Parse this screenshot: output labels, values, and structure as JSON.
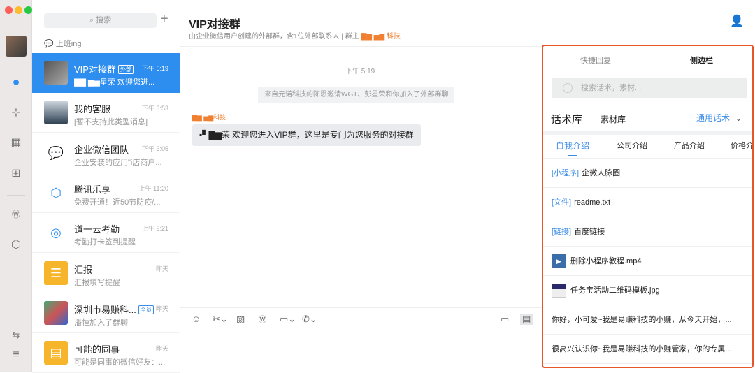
{
  "rail": {
    "items": [
      "avatar",
      "chat-icon",
      "contacts-icon",
      "calendar-icon",
      "apps-icon",
      "document-icon",
      "workbench-icon",
      "switch-icon",
      "menu-icon"
    ]
  },
  "list": {
    "search_placeholder": "搜索",
    "status": "上班ing",
    "items": [
      {
        "name": "VIP对接群",
        "badge": "外部",
        "time": "下午 5:19",
        "sub": "▇▇ ▆▅星荣 欢迎您进...",
        "selected": true
      },
      {
        "name": "我的客服",
        "time": "下午 3:53",
        "sub": "[暂不支持此类型消息]"
      },
      {
        "name": "企业微信团队",
        "time": "下午 3:05",
        "sub": "企业安装的应用\"i店商户..."
      },
      {
        "name": "腾讯乐享",
        "time": "上午 11:20",
        "sub": "免费开通！近50节防疫/..."
      },
      {
        "name": "道一云考勤",
        "time": "上午 9:21",
        "sub": "考勤打卡签到提醒"
      },
      {
        "name": "汇报",
        "time": "昨天",
        "sub": "汇报填写提醒"
      },
      {
        "name": "深圳市易赚科...",
        "badge": "全员",
        "time": "昨天",
        "sub": "潘恒加入了群聊"
      },
      {
        "name": "可能的同事",
        "time": "昨天",
        "sub": "可能是同事的微信好友：..."
      }
    ]
  },
  "chat": {
    "title": "VIP对接群",
    "subtitle": "由企业微信用户创建的外部群，含1位外部联系人 | 群主",
    "owner": "▇▆ ▅▆ 科技",
    "time": "下午 5:19",
    "system": "来自元诺科技的陈思邀请WGT、彭星荣和你加入了外部群聊",
    "sender": "▇▆ ▅▆科技",
    "message": "▪▘▇▆荣 欢迎您进入VIP群，这里是专门为您服务的对接群"
  },
  "panel": {
    "tabs": [
      "快捷回复",
      "侧边栏"
    ],
    "search_placeholder": "搜索话术，素材...",
    "lib_tabs": [
      "话术库",
      "素材库"
    ],
    "category": "通用话术",
    "sub_tabs": [
      "自我介绍",
      "公司介绍",
      "产品介绍",
      "价格介绍"
    ],
    "rows": [
      {
        "tag": "[小程序]",
        "text": "企微人脉圈"
      },
      {
        "tag": "[文件]",
        "text": "readme.txt"
      },
      {
        "tag": "[链接]",
        "text": "百度链接"
      },
      {
        "icon": "video",
        "text": "删除小程序教程.mp4"
      },
      {
        "icon": "image",
        "text": "任务宝活动二维码模板.jpg"
      },
      {
        "text": "你好，小可爱~我是易赚科技的小赚，从今天开始，..."
      },
      {
        "text": "很高兴认识你~我是易赚科技的小赚管家，你的专属..."
      }
    ]
  },
  "colors": {
    "accent": "#2e8ef0",
    "highlight": "#e9552a",
    "orange": "#f08030"
  }
}
